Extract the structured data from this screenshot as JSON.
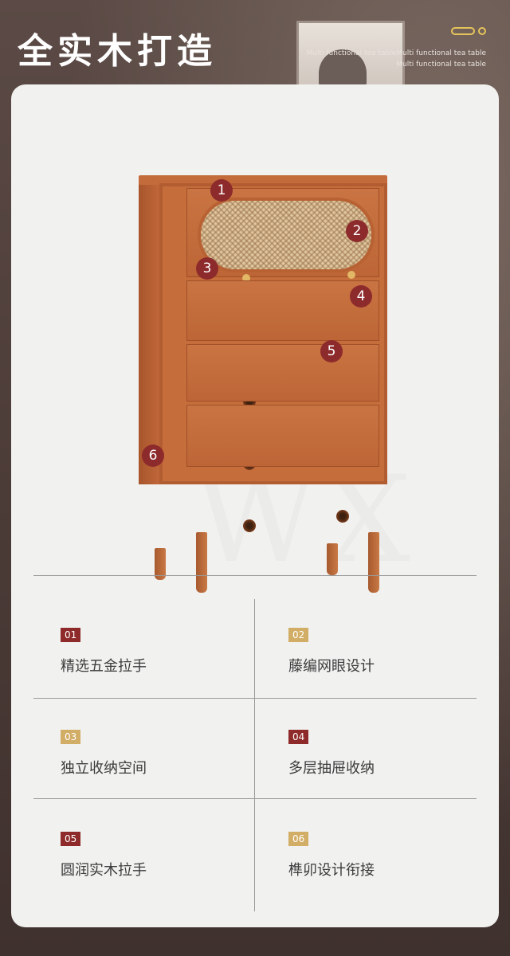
{
  "header": {
    "title": "全实木打造",
    "subtitle_line1": "Multi functional tea tableMulti functional tea table",
    "subtitle_line2": "Multi functional tea table"
  },
  "callouts": [
    "1",
    "2",
    "3",
    "4",
    "5",
    "6"
  ],
  "features": [
    {
      "number": "01",
      "label": "精选五金拉手",
      "badge_color": "#8e2b2a"
    },
    {
      "number": "02",
      "label": "藤编网眼设计",
      "badge_color": "#d2ad66"
    },
    {
      "number": "03",
      "label": "独立收纳空间",
      "badge_color": "#d2ad66"
    },
    {
      "number": "04",
      "label": "多层抽屉收纳",
      "badge_color": "#8e2b2a"
    },
    {
      "number": "05",
      "label": "圆润实木拉手",
      "badge_color": "#8e2b2a"
    },
    {
      "number": "06",
      "label": "榫卯设计衔接",
      "badge_color": "#d2ad66"
    }
  ],
  "colors": {
    "accent_red": "#8e2b2a",
    "accent_gold": "#d2ad66",
    "wood": "#c66d3c",
    "background": "#5a4a45"
  }
}
